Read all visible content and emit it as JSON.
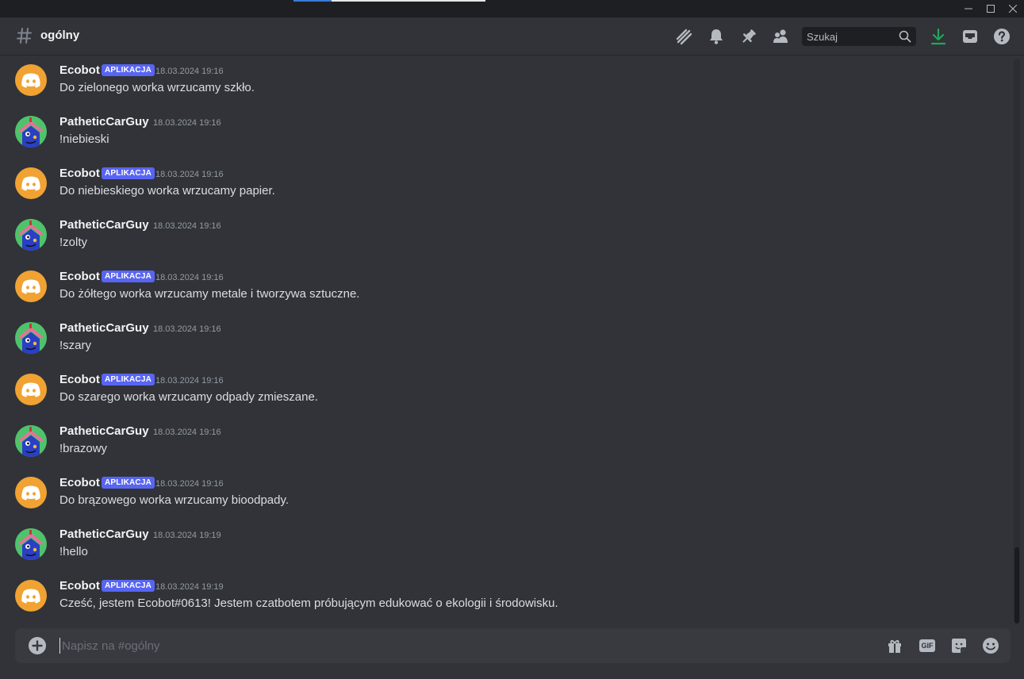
{
  "channel": {
    "name": "ogólny"
  },
  "search": {
    "placeholder": "Szukaj"
  },
  "composer": {
    "placeholder": "Napisz na #ogólny",
    "gif_label": "GIF"
  },
  "colors": {
    "accent": "#5865f2",
    "download": "#23a559",
    "bot_avatar": "#f0a232"
  },
  "messages": [
    {
      "author": "Ecobot",
      "bot": true,
      "badge": "APLIKACJA",
      "time": "18.03.2024 19:16",
      "text": "Do zielonego worka wrzucamy szkło."
    },
    {
      "author": "PatheticCarGuy",
      "bot": false,
      "badge": "",
      "time": "18.03.2024 19:16",
      "text": "!niebieski"
    },
    {
      "author": "Ecobot",
      "bot": true,
      "badge": "APLIKACJA",
      "time": "18.03.2024 19:16",
      "text": "Do niebieskiego worka wrzucamy papier."
    },
    {
      "author": "PatheticCarGuy",
      "bot": false,
      "badge": "",
      "time": "18.03.2024 19:16",
      "text": "!zolty"
    },
    {
      "author": "Ecobot",
      "bot": true,
      "badge": "APLIKACJA",
      "time": "18.03.2024 19:16",
      "text": "Do żółtego worka wrzucamy metale i tworzywa sztuczne."
    },
    {
      "author": "PatheticCarGuy",
      "bot": false,
      "badge": "",
      "time": "18.03.2024 19:16",
      "text": "!szary"
    },
    {
      "author": "Ecobot",
      "bot": true,
      "badge": "APLIKACJA",
      "time": "18.03.2024 19:16",
      "text": "Do szarego worka wrzucamy odpady zmieszane."
    },
    {
      "author": "PatheticCarGuy",
      "bot": false,
      "badge": "",
      "time": "18.03.2024 19:16",
      "text": "!brazowy"
    },
    {
      "author": "Ecobot",
      "bot": true,
      "badge": "APLIKACJA",
      "time": "18.03.2024 19:16",
      "text": "Do brązowego worka wrzucamy bioodpady."
    },
    {
      "author": "PatheticCarGuy",
      "bot": false,
      "badge": "",
      "time": "18.03.2024 19:19",
      "text": "!hello"
    },
    {
      "author": "Ecobot",
      "bot": true,
      "badge": "APLIKACJA",
      "time": "18.03.2024 19:19",
      "text": "Cześć, jestem Ecobot#0613! Jestem czatbotem próbującym edukować o ekologii i środowisku."
    }
  ]
}
